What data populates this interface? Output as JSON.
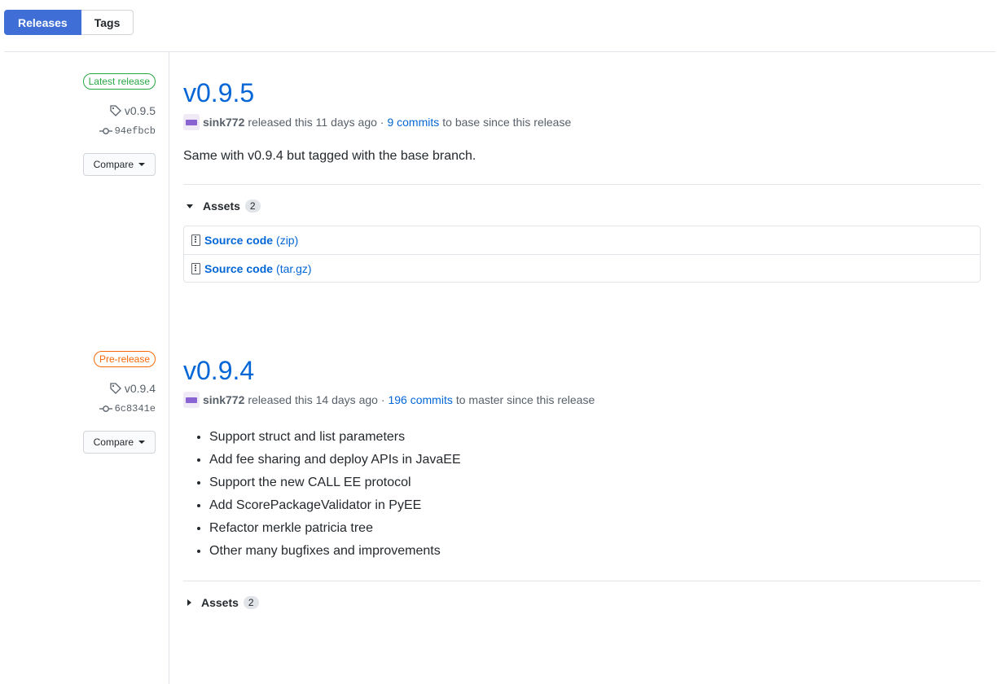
{
  "tabs": {
    "releases": "Releases",
    "tags": "Tags"
  },
  "releases": [
    {
      "badge": "Latest release",
      "tag": "v0.9.5",
      "commit": "94efbcb",
      "compare": "Compare",
      "title": "v0.9.5",
      "author": "sink772",
      "released_text": "released this 11 days ago ·",
      "commits_link": "9 commits",
      "commits_suffix": "to base since this release",
      "body": "Same with v0.9.4 but tagged with the base branch.",
      "assets_label": "Assets",
      "assets_count": "2",
      "assets": [
        {
          "name": "Source code",
          "ext": "(zip)"
        },
        {
          "name": "Source code",
          "ext": "(tar.gz)"
        }
      ]
    },
    {
      "badge": "Pre-release",
      "tag": "v0.9.4",
      "commit": "6c8341e",
      "compare": "Compare",
      "title": "v0.9.4",
      "author": "sink772",
      "released_text": "released this 14 days ago ·",
      "commits_link": "196 commits",
      "commits_suffix": "to master since this release",
      "notes": [
        "Support struct and list parameters",
        "Add fee sharing and deploy APIs in JavaEE",
        "Support the new CALL EE protocol",
        "Add ScorePackageValidator in PyEE",
        "Refactor merkle patricia tree",
        "Other many bugfixes and improvements"
      ],
      "assets_label": "Assets",
      "assets_count": "2"
    }
  ],
  "colors": {
    "accent": "#0366d6",
    "tab_active": "#3f6fd6",
    "latest": "#28a745",
    "prerelease": "#f66a0a"
  }
}
